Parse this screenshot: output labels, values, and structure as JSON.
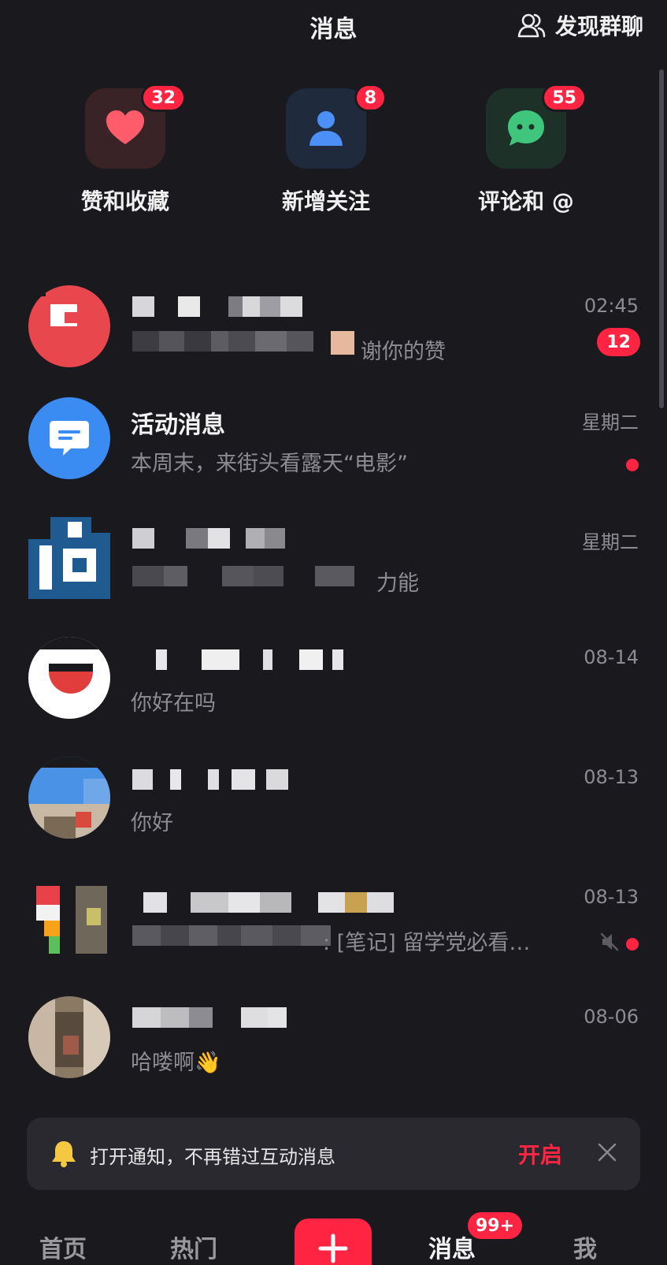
{
  "header": {
    "title": "消息",
    "discover_label": "发现群聊"
  },
  "categories": [
    {
      "label": "赞和收藏",
      "badge": "32",
      "icon": "heart-icon",
      "color": "#ff5c6b"
    },
    {
      "label": "新增关注",
      "badge": "8",
      "icon": "person-icon",
      "color": "#4c8ff6"
    },
    {
      "label": "评论和 @",
      "badge": "55",
      "icon": "chat-bubble-icon",
      "color": "#3fc67c"
    }
  ],
  "chats": [
    {
      "name": "",
      "preview": "谢你的赞",
      "time": "02:45",
      "unread": "12"
    },
    {
      "name": "活动消息",
      "preview": "本周末，来街头看露天“电影”",
      "time": "星期二",
      "dot": true
    },
    {
      "name": "",
      "preview": "力能",
      "time": "星期二"
    },
    {
      "name": "",
      "preview": "你好在吗",
      "time": "08-14"
    },
    {
      "name": "",
      "preview": "你好",
      "time": "08-13"
    },
    {
      "name": "",
      "preview": ": [笔记] 留学党必看…",
      "time": "08-13",
      "dot": true,
      "muted": true
    },
    {
      "name": "",
      "preview": "哈喽啊👋",
      "time": "08-06"
    }
  ],
  "banner": {
    "text": "打开通知，不再错过互动消息",
    "enable_label": "开启"
  },
  "tabbar": {
    "home": "首页",
    "hot": "热门",
    "messages": "消息",
    "messages_badge": "99+",
    "me": "我"
  },
  "colors": {
    "accent": "#ff2442",
    "background": "#1a191e"
  }
}
